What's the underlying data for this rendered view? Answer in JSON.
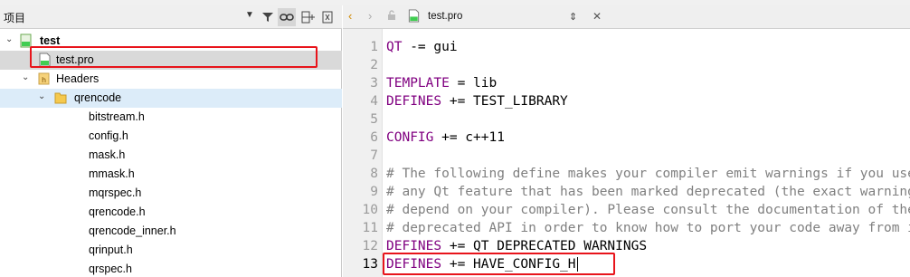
{
  "left_panel": {
    "title": "项目",
    "tree": {
      "root": "test",
      "pro_file": "test.pro",
      "headers_label": "Headers",
      "folder": "qrencode",
      "files": [
        "bitstream.h",
        "config.h",
        "mask.h",
        "mmask.h",
        "mqrspec.h",
        "qrencode.h",
        "qrencode_inner.h",
        "qrinput.h",
        "qrspec.h"
      ]
    }
  },
  "editor": {
    "file_name": "test.pro",
    "current_line": 13,
    "line_numbers": [
      "1",
      "2",
      "3",
      "4",
      "5",
      "6",
      "7",
      "8",
      "9",
      "10",
      "11",
      "12",
      "13"
    ],
    "lines": [
      {
        "kw": "QT",
        "rest": " -= gui"
      },
      {
        "kw": "",
        "rest": ""
      },
      {
        "kw": "TEMPLATE",
        "rest": " = lib"
      },
      {
        "kw": "DEFINES",
        "rest": " += TEST_LIBRARY"
      },
      {
        "kw": "",
        "rest": ""
      },
      {
        "kw": "CONFIG",
        "rest": " += c++11"
      },
      {
        "kw": "",
        "rest": ""
      },
      {
        "comment": "# The following define makes your compiler emit warnings if you use"
      },
      {
        "comment": "# any Qt feature that has been marked deprecated (the exact warnings"
      },
      {
        "comment": "# depend on your compiler). Please consult the documentation of the"
      },
      {
        "comment": "# deprecated API in order to know how to port your code away from it."
      },
      {
        "kw": "DEFINES",
        "rest": " += QT_DEPRECATED_WARNINGS"
      },
      {
        "kw": "DEFINES",
        "rest": " += HAVE_CONFIG_H"
      }
    ]
  },
  "colors": {
    "keyword": "#800080",
    "comment": "#808080",
    "highlight_box": "#e8141b",
    "selection": "#d9d9d9"
  }
}
